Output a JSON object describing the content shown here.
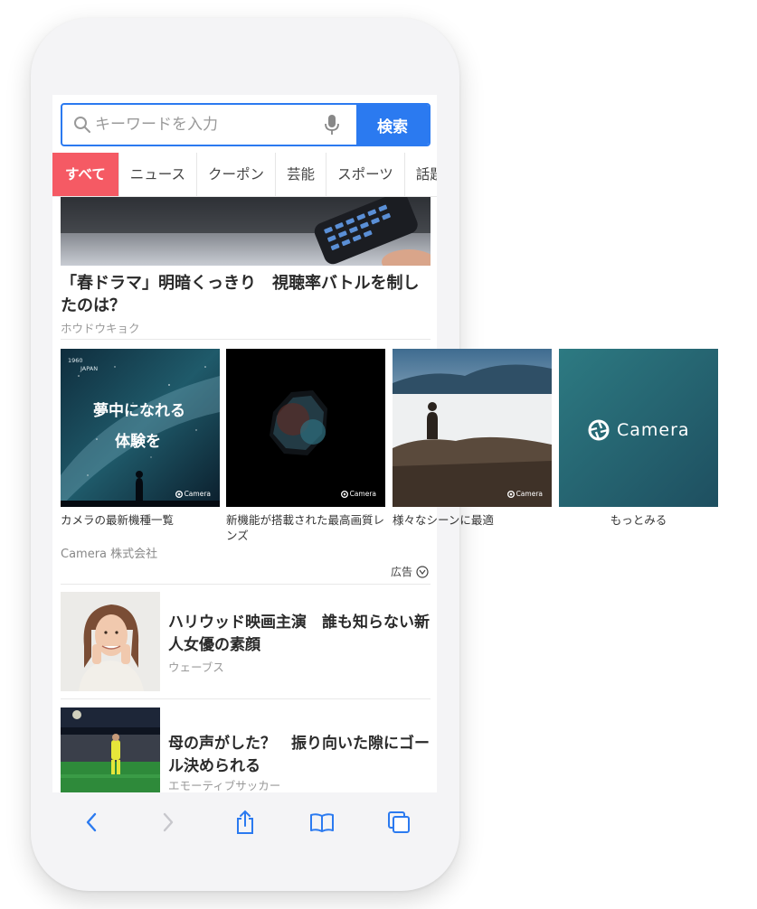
{
  "search": {
    "placeholder": "キーワードを入力",
    "button_label": "検索"
  },
  "tabs": [
    {
      "label": "すべて",
      "active": true
    },
    {
      "label": "ニュース"
    },
    {
      "label": "クーポン"
    },
    {
      "label": "芸能"
    },
    {
      "label": "スポーツ"
    },
    {
      "label": "話題"
    }
  ],
  "hero": {
    "title": "「春ドラマ」明暗くっきり　視聴率バトルを制したのは？",
    "source": "ホウドウキョク"
  },
  "ad": {
    "cards": [
      {
        "caption": "カメラの最新機種一覧",
        "image_text_line1": "夢中になれる",
        "image_text_line2": "体験を",
        "image_small_1": "1960",
        "image_small_2": "JAPAN",
        "badge": "Camera"
      },
      {
        "caption": "新機能が搭載された最高画質レンズ",
        "badge": "Camera"
      },
      {
        "caption": "様々なシーンに最適",
        "badge": "Camera"
      },
      {
        "caption": "もっとみる",
        "tile_text": "Camera"
      }
    ],
    "advertiser": "Camera 株式会社",
    "ad_label": "広告"
  },
  "news": [
    {
      "title": "ハリウッド映画主演　誰も知らない新人女優の素顔",
      "source": "ウェーブス"
    },
    {
      "title": "母の声がした？　振り向いた隙にゴール決められる",
      "source": "エモーティブサッカー"
    }
  ],
  "colors": {
    "accent": "#2b7af0",
    "active_tab": "#f55a64",
    "teal": "#2d7a82"
  },
  "toolbar": {
    "icons": [
      "back-icon",
      "forward-icon",
      "share-icon",
      "bookmarks-icon",
      "tabs-icon"
    ]
  }
}
